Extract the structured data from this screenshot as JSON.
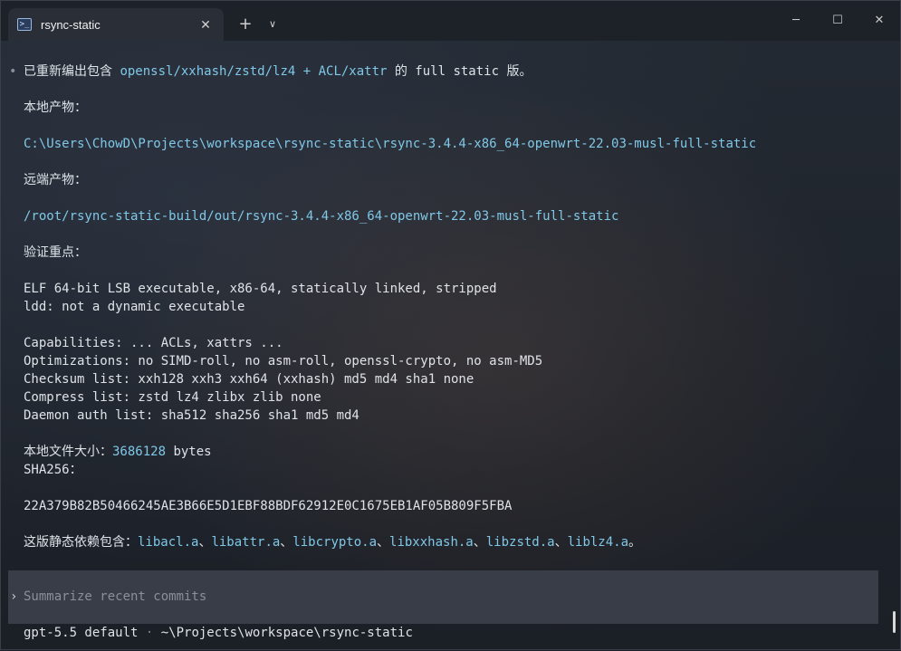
{
  "tab": {
    "title": "rsync-static",
    "icon": "powershell-icon"
  },
  "window_buttons": {
    "minimize": "─",
    "maximize": "☐",
    "close": "✕"
  },
  "output": {
    "l1": {
      "pre": "已重新编出包含 ",
      "hl": "openssl/xxhash/zstd/lz4 + ACL/xattr",
      "post": " 的 full static 版。"
    },
    "local_label": "本地产物：",
    "local_path": "C:\\Users\\ChowD\\Projects\\workspace\\rsync-static\\rsync-3.4.4-x86_64-openwrt-22.03-musl-full-static",
    "remote_label": "远端产物：",
    "remote_path": "/root/rsync-static-build/out/rsync-3.4.4-x86_64-openwrt-22.03-musl-full-static",
    "verify_label": "验证重点：",
    "elf": "ELF 64-bit LSB executable, x86-64, statically linked, stripped",
    "ldd": "ldd: not a dynamic executable",
    "caps": "Capabilities: ... ACLs, xattrs ...",
    "opts": "Optimizations: no SIMD-roll, no asm-roll, openssl-crypto, no asm-MD5",
    "checksum": "Checksum list: xxh128 xxh3 xxh64 (xxhash) md5 md4 sha1 none",
    "compress": "Compress list: zstd lz4 zlibx zlib none",
    "daemon": "Daemon auth list: sha512 sha256 sha1 md5 md4",
    "size_label": "本地文件大小：",
    "size_value": "3686128",
    "size_unit": " bytes",
    "sha_label": "SHA256：",
    "sha_value": "22A379B82B50466245AE3B66E5D1EBF88BDF62912E0C1675EB1AF05B809F5FBA",
    "deps_label": "这版静态依赖包含：",
    "deps": [
      "libacl.a",
      "libattr.a",
      "libcrypto.a",
      "libxxhash.a",
      "libzstd.a",
      "liblz4.a"
    ],
    "deps_sep": "、",
    "deps_end": "。"
  },
  "prompt": {
    "placeholder": "Summarize recent commits",
    "arrow": "›"
  },
  "status": {
    "model": "gpt-5.5 default",
    "sep": " · ",
    "cwd": "~\\Projects\\workspace\\rsync-static"
  }
}
